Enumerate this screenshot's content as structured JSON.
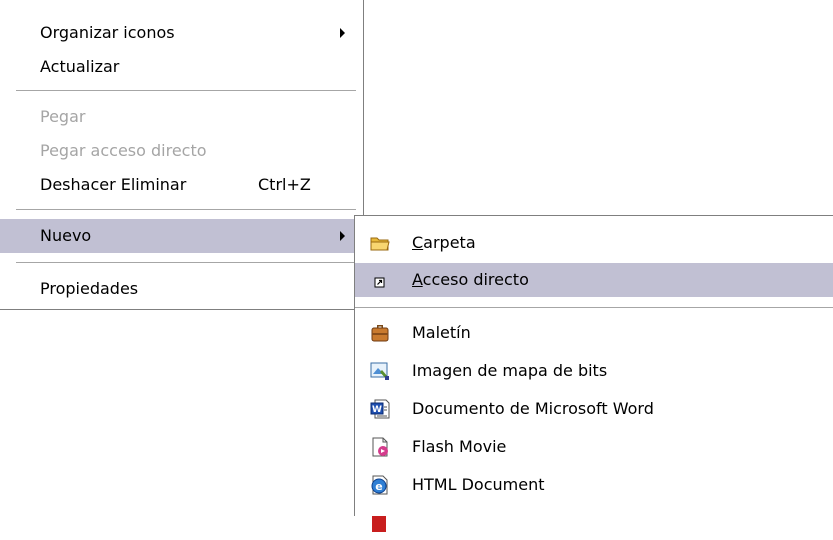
{
  "main_menu": {
    "items": [
      {
        "label": "Organizar iconos"
      },
      {
        "label": "Actualizar"
      },
      {
        "label": "Pegar"
      },
      {
        "label": "Pegar acceso directo"
      },
      {
        "label": "Deshacer Eliminar",
        "shortcut": "Ctrl+Z"
      },
      {
        "label": "Nuevo"
      },
      {
        "label": "Propiedades"
      }
    ]
  },
  "sub_menu": {
    "items": [
      {
        "mnemonic": "C",
        "rest": "arpeta",
        "icon": "folder-icon"
      },
      {
        "mnemonic": "A",
        "rest": "cceso directo",
        "icon": "shortcut-icon"
      },
      {
        "label": "Maletín",
        "icon": "briefcase-icon"
      },
      {
        "label": "Imagen de mapa de bits",
        "icon": "bitmap-image-icon"
      },
      {
        "label": "Documento de Microsoft Word",
        "icon": "word-document-icon"
      },
      {
        "label": "Flash Movie",
        "icon": "flash-movie-icon"
      },
      {
        "label": "HTML Document",
        "icon": "html-document-icon"
      }
    ]
  },
  "colors": {
    "highlight": "#c1c0d3",
    "disabled_text": "#a5a5a5",
    "separator": "#a6a6a6"
  }
}
